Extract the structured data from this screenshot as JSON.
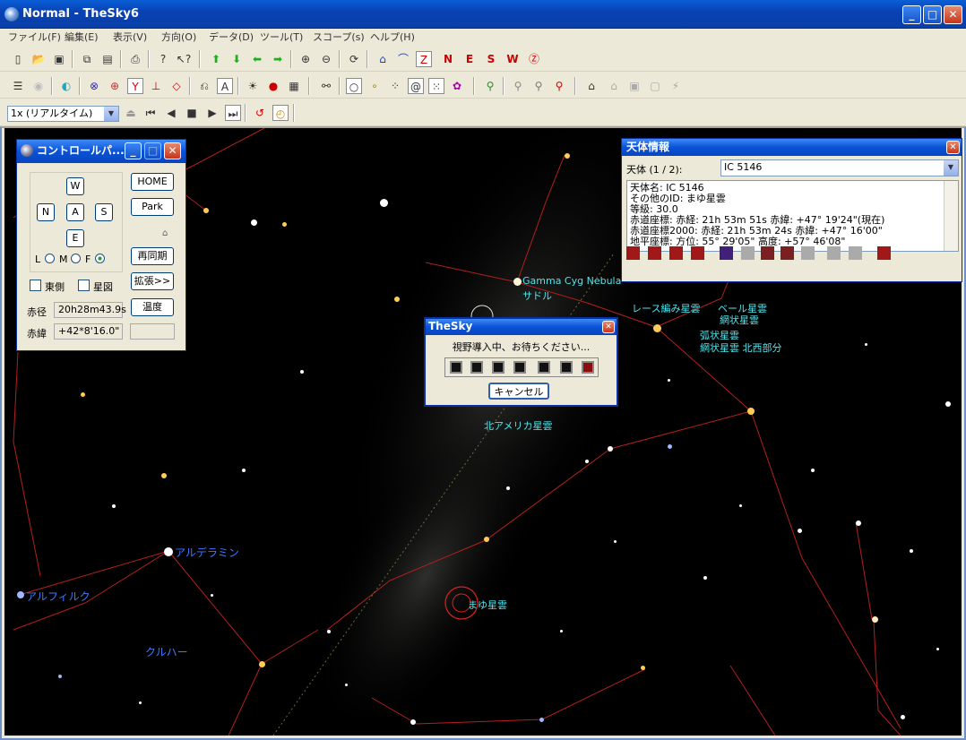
{
  "window": {
    "title": "Normal - TheSky6"
  },
  "menu": [
    "ファイル(F)",
    "編集(E)",
    "表示(V)",
    "方向(O)",
    "データ(D)",
    "ツール(T)",
    "スコープ(s)",
    "ヘルプ(H)"
  ],
  "timebar": {
    "rate": "1x (リアルタイム)"
  },
  "control_panel": {
    "title": "コントロールパ...",
    "dir": {
      "w": "W",
      "n": "N",
      "a": "A",
      "s": "S",
      "e": "E"
    },
    "lmf": {
      "l": "L",
      "m": "M",
      "f": "F"
    },
    "buttons": {
      "home": "HOME",
      "park": "Park",
      "resync": "再同期",
      "expand": "拡張>>",
      "temp": "温度"
    },
    "checks": {
      "east": "東側",
      "chart": "星図"
    },
    "ra_label": "赤径",
    "ra_value": "20h28m43.9s",
    "dec_label": "赤緯",
    "dec_value": "+42*8'16.0\""
  },
  "info_panel": {
    "title": "天体情報",
    "object_label": "天体 (1 / 2):",
    "object_value": "IC 5146",
    "lines": [
      "天体名: IC 5146",
      "その他のID: まゆ星雲",
      "等級: 30.0",
      "赤道座標: 赤経: 21h 53m 51s  赤緯: +47° 19'24\"(現在)",
      "赤道座標2000: 赤経: 21h 53m 24s  赤緯: +47° 16'00\"",
      "地平座標: 方位: 55° 29'05\"  高度: +57° 46'08\""
    ]
  },
  "dialog": {
    "title": "TheSky",
    "message": "視野導入中、お待ちください...",
    "cancel": "キャンセル"
  },
  "sky_labels": {
    "gamma": "Gamma Cyg Nebula",
    "sadr": "サドル",
    "lace": "レース編み星雲",
    "veil": "ベール星雲",
    "mesh": "網状星雲",
    "arc": "弧状星雲",
    "mesh_nw": "網状星雲 北西部分",
    "na": "北アメリカ星雲",
    "cocoon": "まゆ星雲",
    "alderamin": "アルデラミン",
    "alfirk": "アルフィルク",
    "kurhah": "クルハー"
  },
  "colors": {
    "sky": "#000000",
    "cyan_label": "#4fe6ee",
    "blue_label": "#3c7bff",
    "constellation_line": "#b51e1e"
  }
}
